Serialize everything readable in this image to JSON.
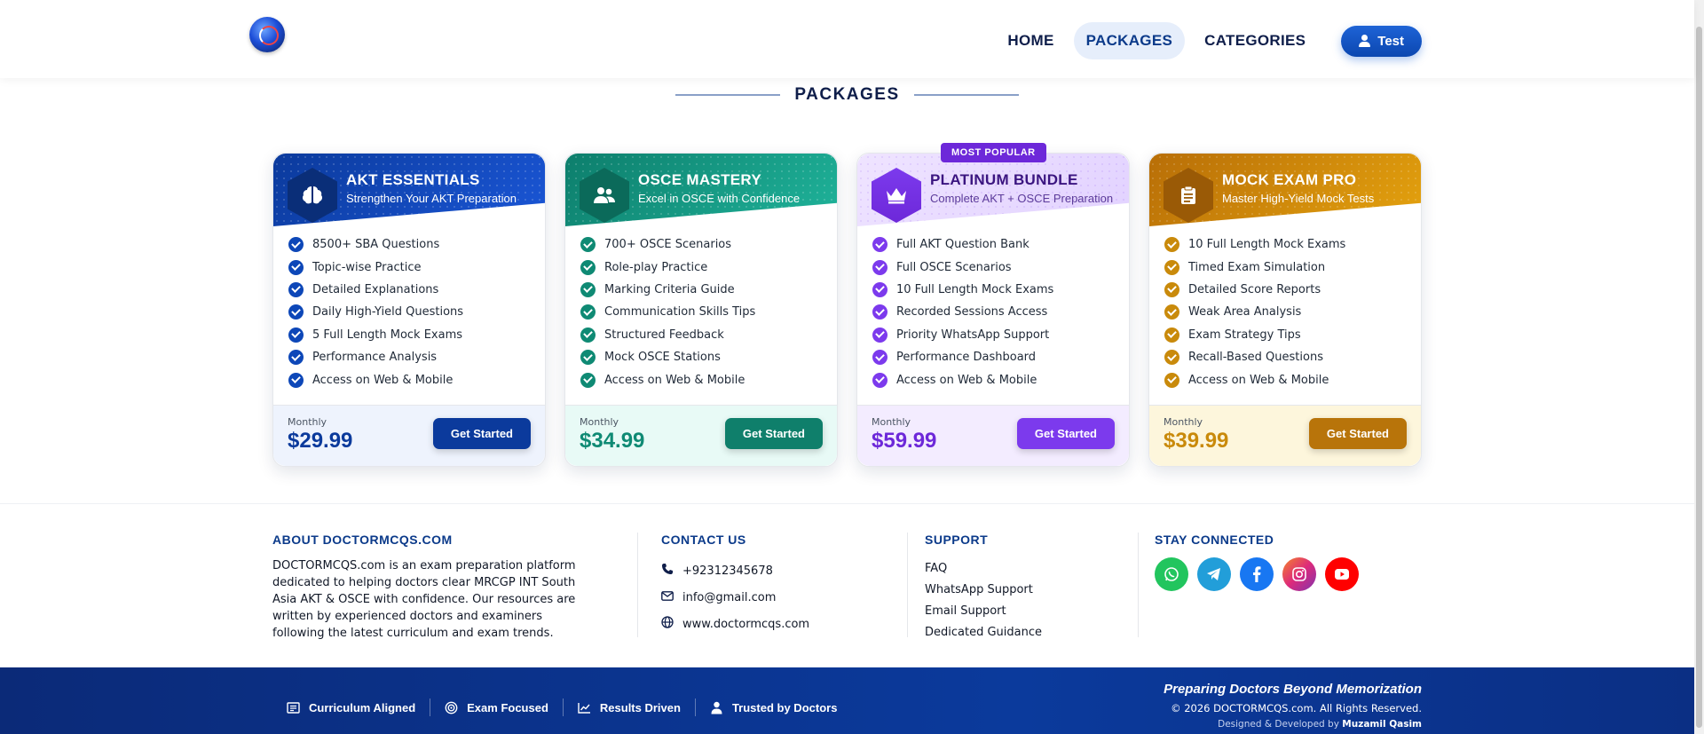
{
  "nav": {
    "links": [
      "HOME",
      "PACKAGES",
      "CATEGORIES"
    ],
    "user_label": "Test"
  },
  "section_title": "PACKAGES",
  "packages": [
    {
      "title": "AKT ESSENTIALS",
      "subtitle": "Strengthen Your AKT Preparation",
      "icon": "brain-icon",
      "features": [
        "8500+ SBA Questions",
        "Topic-wise Practice",
        "Detailed Explanations",
        "Daily High-Yield Questions",
        "5 Full Length Mock Exams",
        "Performance Analysis",
        "Access on Web & Mobile"
      ],
      "period": "Monthly",
      "price": "$29.99",
      "cta": "Get Started",
      "accent": "#0b3a9c"
    },
    {
      "title": "OSCE MASTERY",
      "subtitle": "Excel in OSCE with Confidence",
      "icon": "users-icon",
      "features": [
        "700+ OSCE Scenarios",
        "Role-play Practice",
        "Marking Criteria Guide",
        "Communication Skills Tips",
        "Structured Feedback",
        "Mock OSCE Stations",
        "Access on Web & Mobile"
      ],
      "period": "Monthly",
      "price": "$34.99",
      "cta": "Get Started",
      "accent": "#0f8a74"
    },
    {
      "badge": "MOST POPULAR",
      "title": "PLATINUM BUNDLE",
      "subtitle": "Complete AKT + OSCE Preparation",
      "icon": "crown-icon",
      "features": [
        "Full AKT Question Bank",
        "Full OSCE Scenarios",
        "10 Full Length Mock Exams",
        "Recorded Sessions Access",
        "Priority WhatsApp Support",
        "Performance Dashboard",
        "Access on Web & Mobile"
      ],
      "period": "Monthly",
      "price": "$59.99",
      "cta": "Get Started",
      "accent": "#7c3aed"
    },
    {
      "title": "MOCK EXAM PRO",
      "subtitle": "Master High-Yield Mock Tests",
      "icon": "clipboard-icon",
      "features": [
        "10 Full Length Mock Exams",
        "Timed Exam Simulation",
        "Detailed Score Reports",
        "Weak Area Analysis",
        "Exam Strategy Tips",
        "Recall-Based Questions",
        "Access on Web & Mobile"
      ],
      "period": "Monthly",
      "price": "$39.99",
      "cta": "Get Started",
      "accent": "#c98a0b"
    }
  ],
  "footer": {
    "about_title": "ABOUT DOCTORMCQS.COM",
    "about_text": "DOCTORMCQS.com is an exam preparation platform dedicated to helping doctors clear MRCGP INT South Asia AKT & OSCE with confidence. Our resources are written by experienced doctors and examiners following the latest curriculum and exam trends.",
    "contact_title": "CONTACT US",
    "phone": "+92312345678",
    "email": "info@gmail.com",
    "website": "www.doctormcqs.com",
    "support_title": "SUPPORT",
    "support_links": [
      "FAQ",
      "WhatsApp Support",
      "Email Support",
      "Dedicated Guidance"
    ],
    "social_title": "STAY CONNECTED",
    "socials": [
      {
        "icon": "whatsapp-icon",
        "color": "#22c55e"
      },
      {
        "icon": "telegram-icon",
        "color": "#229ed9"
      },
      {
        "icon": "facebook-icon",
        "color": "#1877f2"
      },
      {
        "icon": "instagram-icon",
        "color": "#d6336c"
      },
      {
        "icon": "youtube-icon",
        "color": "#ff0000"
      }
    ]
  },
  "bottom": {
    "features": [
      "Curriculum Aligned",
      "Exam Focused",
      "Results Driven",
      "Trusted by Doctors"
    ],
    "tagline": "Preparing Doctors Beyond Memorization",
    "copyright": "© 2026 DOCTORMCQS.com. All Rights Reserved.",
    "designed_prefix": "Designed & Developed by",
    "designed_by": "Muzamil Qasim"
  }
}
